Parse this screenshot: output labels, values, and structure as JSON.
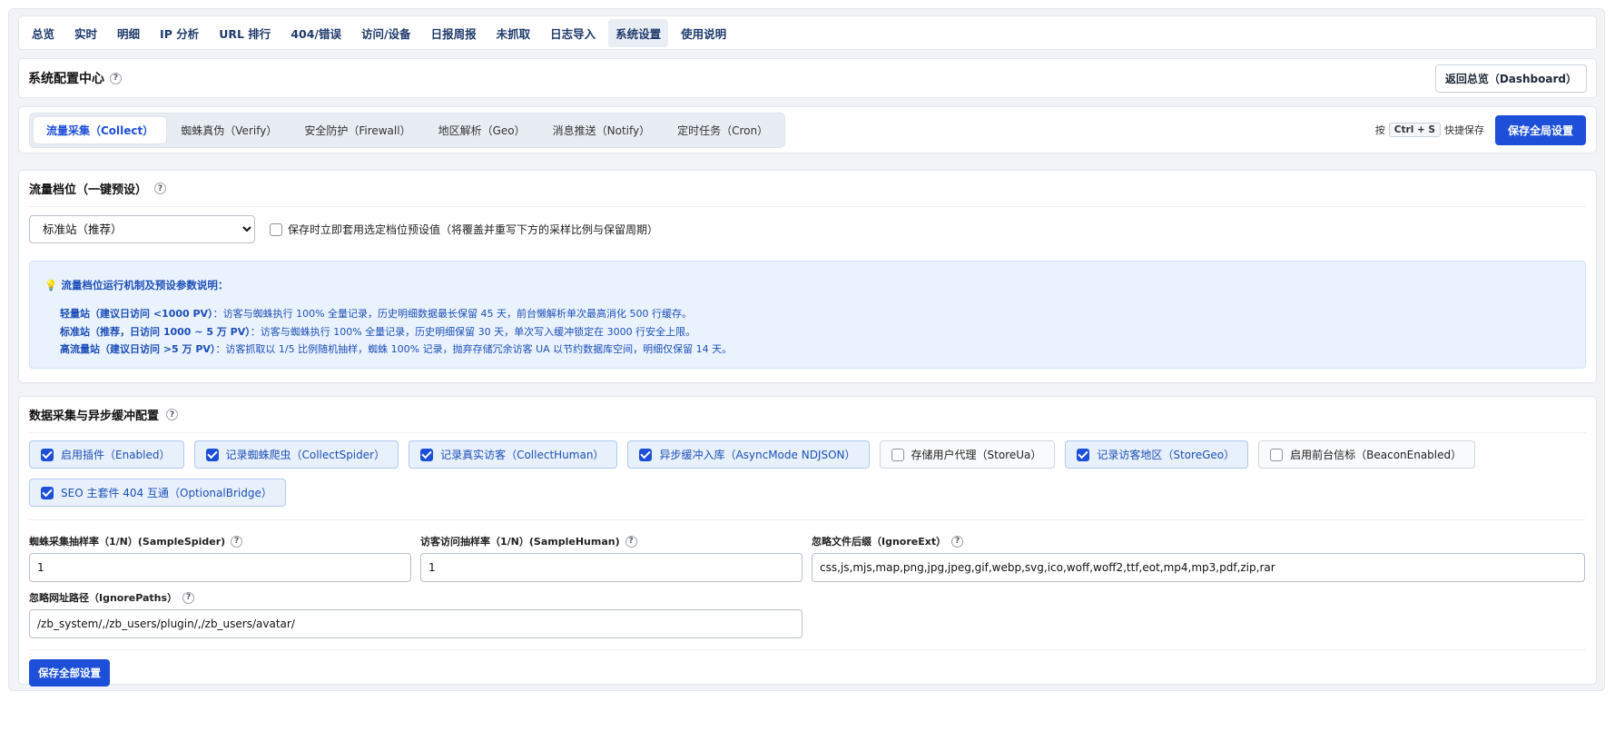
{
  "nav": {
    "tabs": [
      "总览",
      "实时",
      "明细",
      "IP 分析",
      "URL 排行",
      "404/错误",
      "访问/设备",
      "日报周报",
      "未抓取",
      "日志导入",
      "系统设置",
      "使用说明"
    ],
    "active_index": 10
  },
  "header": {
    "title": "系统配置中心",
    "help": "?",
    "back_button": "返回总览（Dashboard）"
  },
  "subtabs": {
    "items": [
      "流量采集（Collect）",
      "蜘蛛真伪（Verify）",
      "安全防护（Firewall）",
      "地区解析（Geo）",
      "消息推送（Notify）",
      "定时任务（Cron）"
    ],
    "active_index": 0,
    "shortcut_prefix": "按",
    "shortcut_key": "Ctrl + S",
    "shortcut_suffix": "快捷保存",
    "save_global": "保存全局设置"
  },
  "tier": {
    "title": "流量档位（一键预设）",
    "selected": "标准站（推荐）",
    "apply_checkbox": {
      "label": "保存时立即套用选定档位预设值（将覆盖并重写下方的采样比例与保留周期）",
      "checked": false
    },
    "info": {
      "icon": "lightbulb-icon",
      "heading": "流量档位运行机制及预设参数说明：",
      "lines": [
        {
          "strong": "轻量站（建议日访问 <1000 PV）",
          "text": "：访客与蜘蛛执行 100% 全量记录，历史明细数据最长保留 45 天，前台懒解析单次最高消化 500 行缓存。"
        },
        {
          "strong": "标准站（推荐，日访问 1000 ~ 5 万 PV）",
          "text": "：访客与蜘蛛执行 100% 全量记录，历史明细保留 30 天，单次写入缓冲锁定在 3000 行安全上限。"
        },
        {
          "strong": "高流量站（建议日访问 >5 万 PV）",
          "text": "：访客抓取以 1/5 比例随机抽样，蜘蛛 100% 记录，抛弃存储冗余访客 UA 以节约数据库空间，明细仅保留 14 天。"
        }
      ]
    }
  },
  "collect": {
    "title": "数据采集与异步缓冲配置",
    "options": [
      {
        "label": "启用插件（Enabled）",
        "checked": true
      },
      {
        "label": "记录蜘蛛爬虫（CollectSpider）",
        "checked": true
      },
      {
        "label": "记录真实访客（CollectHuman）",
        "checked": true
      },
      {
        "label": "异步缓冲入库（AsyncMode NDJSON）",
        "checked": true
      },
      {
        "label": "存储用户代理（StoreUa）",
        "checked": false
      },
      {
        "label": "记录访客地区（StoreGeo）",
        "checked": true
      },
      {
        "label": "启用前台信标（BeaconEnabled）",
        "checked": false
      },
      {
        "label": "SEO 主套件 404 互通（OptionalBridge）",
        "checked": true
      }
    ],
    "fields": {
      "sample_spider": {
        "label": "蜘蛛采集抽样率（1/N）(SampleSpider)",
        "value": "1"
      },
      "sample_human": {
        "label": "访客访问抽样率（1/N）(SampleHuman)",
        "value": "1"
      },
      "ignore_ext": {
        "label": "忽略文件后缀（IgnoreExt）",
        "value": "css,js,mjs,map,png,jpg,jpeg,gif,webp,svg,ico,woff,woff2,ttf,eot,mp4,mp3,pdf,zip,rar"
      },
      "ignore_paths": {
        "label": "忽略网址路径（IgnorePaths）",
        "value": "/zb_system/,/zb_users/plugin/,/zb_users/avatar/"
      }
    },
    "save_all": "保存全部设置"
  }
}
